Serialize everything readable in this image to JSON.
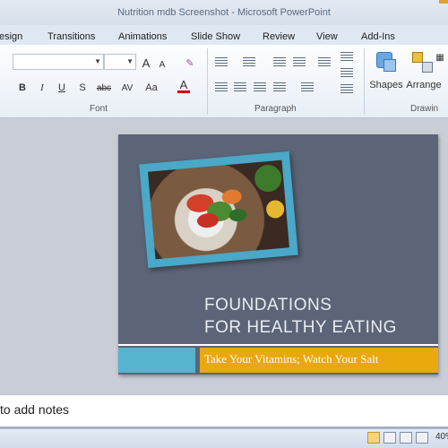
{
  "window": {
    "title": "Nutrition mdb Screenshot - Microsoft PowerPoint"
  },
  "ribbon_tabs": [
    "esign",
    "Transitions",
    "Animations",
    "Slide Show",
    "Review",
    "View",
    "Add-Ins"
  ],
  "ribbon": {
    "groups": {
      "font": "Font",
      "paragraph": "Paragraph",
      "drawing": "Drawin"
    },
    "buttons": {
      "shapes": "Shapes",
      "arrange": "Arrange"
    },
    "font_controls": {
      "bold": "B",
      "italic": "I",
      "underline": "U",
      "shadow": "S",
      "strike": "abc",
      "spacing": "AV",
      "case": "Aa",
      "color": "A",
      "grow": "A",
      "shrink": "A"
    }
  },
  "slide": {
    "title_line1": "FOUNDATIONS",
    "title_line2": "FOR HEALTHY EATING",
    "subtitle": "Take Your Vitamins; Watch Your Salt"
  },
  "notes": {
    "placeholder": "to add notes"
  },
  "status": {
    "zoom": "40%"
  },
  "colors": {
    "slide_bg": "#5c6577",
    "accent_blue": "#56b4cf",
    "accent_orange": "#e9a80c"
  }
}
